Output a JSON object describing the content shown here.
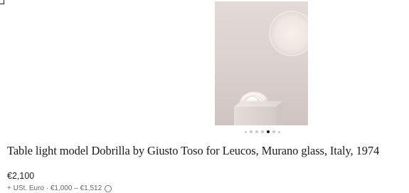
{
  "product": {
    "image_alt": "Dobrilla table light by Giusto Toso on a white pedestal",
    "title": "Table light model Dobrilla by Giusto Toso for Leucos, Murano glass, Italy, 1974",
    "price": "€2,100",
    "secondary_line": "+ USt. Euro · €1,000 – €1,512"
  },
  "carousel": {
    "dot_count": 7,
    "active_index": 4
  },
  "icons": {
    "info": "info-circle-icon"
  }
}
